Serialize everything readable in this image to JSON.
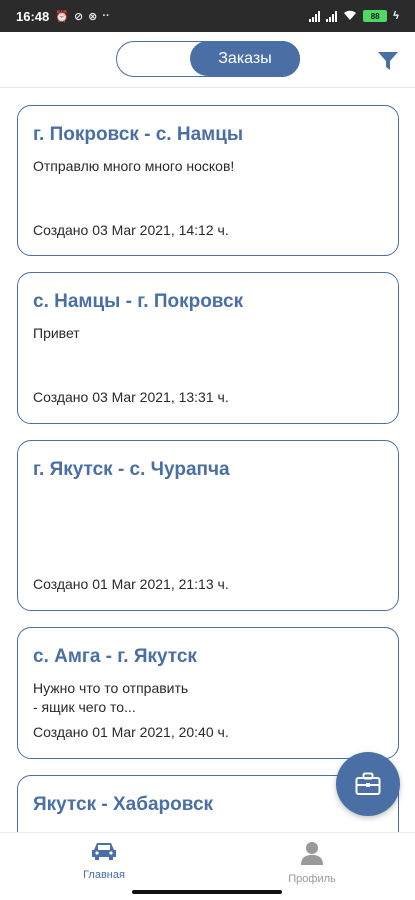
{
  "status_bar": {
    "time": "16:48",
    "battery": "88"
  },
  "header": {
    "segment_active_label": "Заказы"
  },
  "orders": [
    {
      "title": "г. Покровск - с. Намцы",
      "description": "Отправлю много много носков!",
      "created": "Создано 03 Mar 2021, 14:12 ч."
    },
    {
      "title": "с. Намцы - г. Покровск",
      "description": "Привет",
      "created": "Создано 03 Mar 2021, 13:31 ч."
    },
    {
      "title": "г. Якутск - с. Чурапча",
      "description": "",
      "created": "Создано 01 Mar 2021, 21:13 ч."
    },
    {
      "title": "с. Амга - г. Якутск",
      "description": "Нужно что то отправить\n- ящик чего то...",
      "created": "Создано 01 Mar 2021, 20:40 ч."
    },
    {
      "title": "Якутск - Хабаровск",
      "description": "",
      "created": ""
    }
  ],
  "bottom_nav": {
    "home_label": "Главная",
    "profile_label": "Профиль"
  },
  "colors": {
    "accent": "#4a6fa5",
    "inactive": "#999999"
  },
  "icons": {
    "filter": "filter-icon",
    "briefcase": "briefcase-icon",
    "car": "car-icon",
    "user": "user-icon"
  }
}
